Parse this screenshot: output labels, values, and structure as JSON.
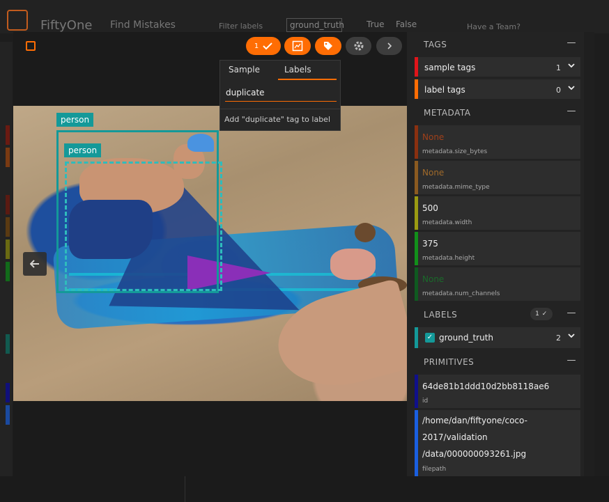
{
  "background": {
    "brand": "FiftyOne",
    "dataset_name": "Find Mistakes",
    "filter_label": "Filter labels",
    "ground_truth_chip": "ground_truth",
    "true_label": "True",
    "false_label": "False",
    "team_prompt": "Have a Team?"
  },
  "toolbar": {
    "selected_count": "1",
    "accent_color": "#ff6d04"
  },
  "tag_popup": {
    "tabs": [
      "Sample",
      "Labels"
    ],
    "active_tab": "Labels",
    "input_value": "duplicate",
    "action": "Add \"duplicate\" tag to label"
  },
  "image": {
    "detections": [
      {
        "label": "person",
        "style": "solid"
      },
      {
        "label": "person",
        "style": "dashed"
      }
    ]
  },
  "sidebar": {
    "tags": {
      "title": "TAGS",
      "collapse": "—",
      "items": [
        {
          "label": "sample tags",
          "count": "1",
          "color": "#e0151a"
        },
        {
          "label": "label tags",
          "count": "0",
          "color": "#ff6d04"
        }
      ]
    },
    "metadata": {
      "title": "METADATA",
      "collapse": "—",
      "fields": [
        {
          "value": "None",
          "key": "metadata.size_bytes",
          "color": "#8b3010"
        },
        {
          "value": "None",
          "key": "metadata.mime_type",
          "color": "#8b5a20"
        },
        {
          "value": "500",
          "key": "metadata.width",
          "color": "#9a9a12"
        },
        {
          "value": "375",
          "key": "metadata.height",
          "color": "#12901a"
        },
        {
          "value": "None",
          "key": "metadata.num_channels",
          "color": "#0f5a20"
        }
      ]
    },
    "labels": {
      "title": "LABELS",
      "badge": "1",
      "collapse": "—",
      "items": [
        {
          "label": "ground_truth",
          "count": "2",
          "color": "#149999"
        }
      ]
    },
    "primitives": {
      "title": "PRIMITIVES",
      "collapse": "—",
      "fields": [
        {
          "value": "64de81b1ddd10d2bb8118ae6",
          "key": "id",
          "color": "#10108a"
        },
        {
          "value_lines": [
            "/home/dan/fiftyone/coco-",
            "2017/validation",
            "/data/000000093261.jpg"
          ],
          "key": "filepath",
          "color": "#1a5fe0"
        }
      ]
    }
  }
}
